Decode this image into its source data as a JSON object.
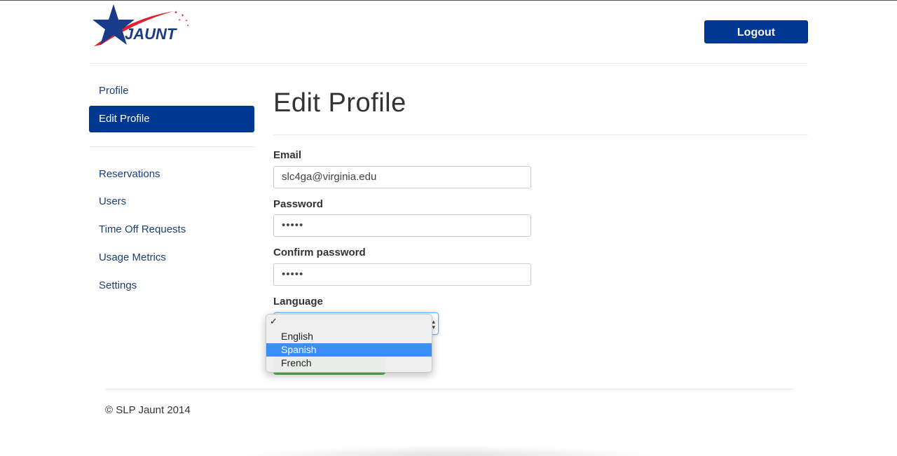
{
  "header": {
    "logo_text": "JAUNT",
    "logout_label": "Logout"
  },
  "sidebar": {
    "primary": [
      {
        "label": "Profile",
        "active": false
      },
      {
        "label": "Edit Profile",
        "active": true
      }
    ],
    "secondary": [
      {
        "label": "Reservations"
      },
      {
        "label": "Users"
      },
      {
        "label": "Time Off Requests"
      },
      {
        "label": "Usage Metrics"
      },
      {
        "label": "Settings"
      }
    ]
  },
  "main": {
    "title": "Edit Profile",
    "email": {
      "label": "Email",
      "value": "slc4ga@virginia.edu"
    },
    "password": {
      "label": "Password",
      "value": "•••••"
    },
    "confirm_password": {
      "label": "Confirm password",
      "value": "•••••"
    },
    "language": {
      "label": "Language",
      "check_mark": "✓",
      "options": [
        "English",
        "Spanish",
        "French"
      ],
      "highlighted": "Spanish"
    }
  },
  "footer": {
    "copyright": "© SLP Jaunt 2014"
  },
  "colors": {
    "brand_blue": "#003893",
    "link_blue": "#1a3f7a",
    "logo_red": "#e0202c",
    "highlight_blue": "#3a8ef6",
    "submit_green": "#5cb85c"
  }
}
